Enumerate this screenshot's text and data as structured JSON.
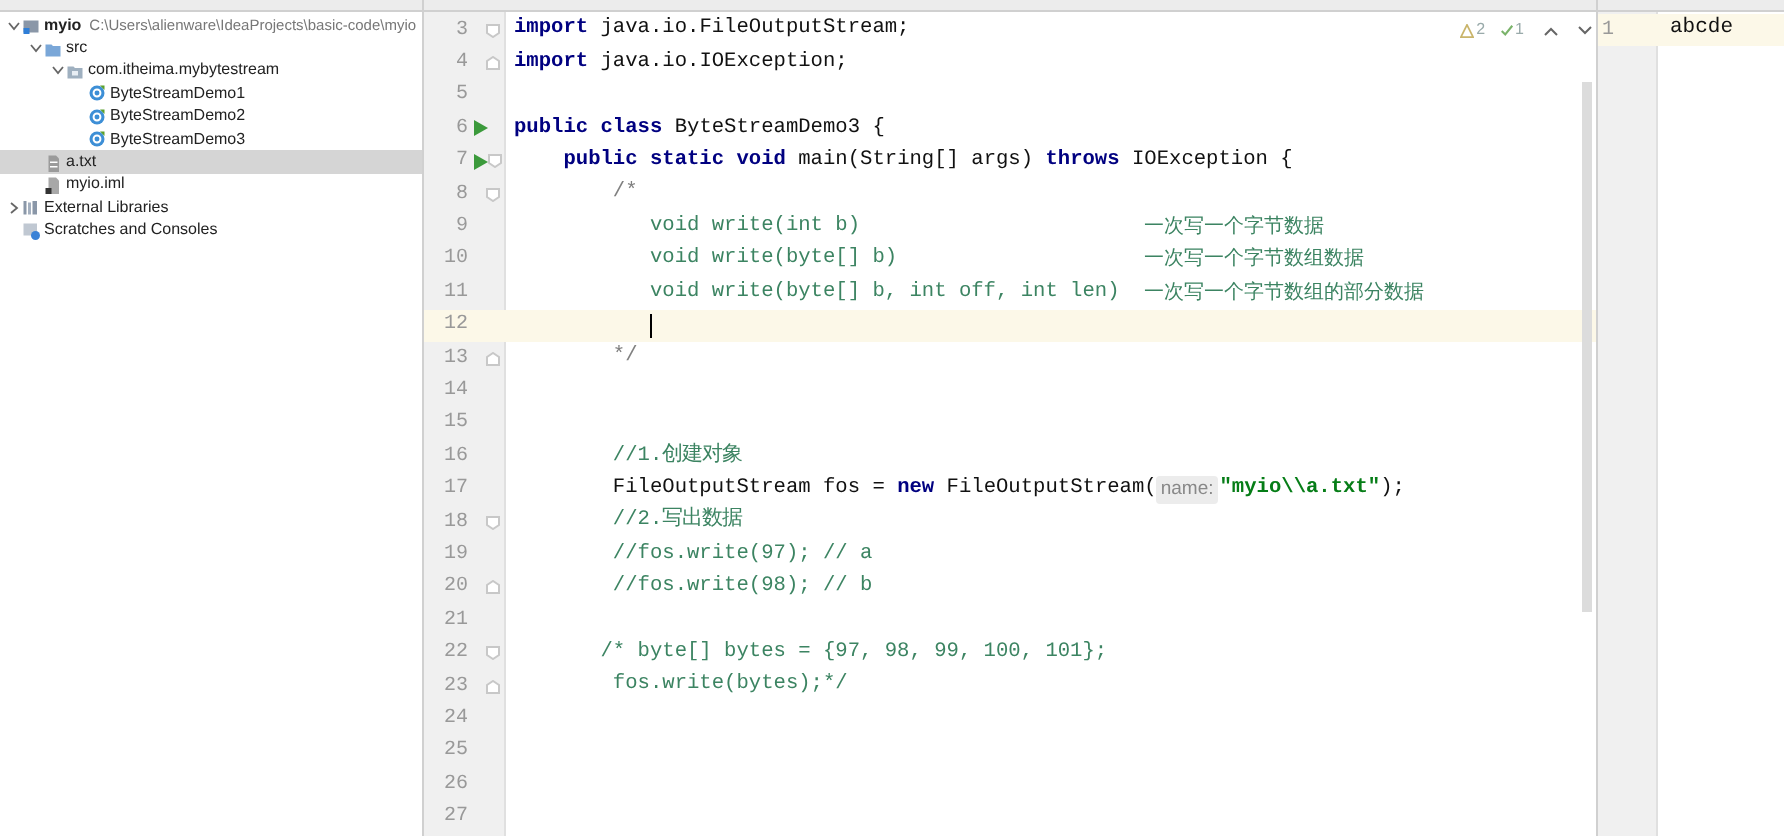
{
  "project_tree": [
    {
      "label": "myio",
      "path": "C:\\Users\\alienware\\IdeaProjects\\basic-code\\myio",
      "kind": "module",
      "expanded": true,
      "selected": false,
      "children": [
        {
          "label": "src",
          "kind": "folder",
          "expanded": true,
          "selected": false,
          "children": [
            {
              "label": "com.itheima.mybytestream",
              "kind": "package",
              "expanded": true,
              "selected": false,
              "children": [
                {
                  "label": "ByteStreamDemo1",
                  "kind": "class",
                  "selected": false
                },
                {
                  "label": "ByteStreamDemo2",
                  "kind": "class",
                  "selected": false
                },
                {
                  "label": "ByteStreamDemo3",
                  "kind": "class",
                  "selected": false
                }
              ]
            }
          ]
        },
        {
          "label": "a.txt",
          "kind": "text",
          "selected": true
        },
        {
          "label": "myio.iml",
          "kind": "iml",
          "selected": false
        }
      ]
    },
    {
      "label": "External Libraries",
      "kind": "libraries",
      "expanded": false,
      "selected": false
    },
    {
      "label": "Scratches and Consoles",
      "kind": "scratches",
      "selected": false
    }
  ],
  "inspections": {
    "warnings": "2",
    "weak_warnings": "1"
  },
  "code_lines": [
    {
      "number": "3",
      "segments": [
        {
          "kind": "keyword",
          "text": "import"
        },
        {
          "kind": "plain",
          "text": " java.io.FileOutputStream;"
        }
      ],
      "fold_open": true
    },
    {
      "number": "4",
      "segments": [
        {
          "kind": "keyword",
          "text": "import"
        },
        {
          "kind": "plain",
          "text": " java.io.IOException;"
        }
      ],
      "fold_close": true
    },
    {
      "number": "5"
    },
    {
      "number": "6",
      "segments": [
        {
          "kind": "keyword",
          "text": "public class"
        },
        {
          "kind": "plain",
          "text": " ByteStreamDemo3 {"
        }
      ],
      "run": true
    },
    {
      "number": "7",
      "segments": [
        {
          "kind": "keyword",
          "text": "    public static void"
        },
        {
          "kind": "plain",
          "text": " main(String[] args) "
        },
        {
          "kind": "keyword",
          "text": "throws"
        },
        {
          "kind": "plain",
          "text": " IOException {"
        }
      ],
      "run": true,
      "fold_open": true
    },
    {
      "number": "8",
      "segments": [
        {
          "kind": "comment-mark",
          "text": "        /*"
        }
      ],
      "fold_open": true
    },
    {
      "number": "9",
      "segments": [
        {
          "kind": "comment",
          "text": "           void write(int b)"
        }
      ],
      "note": "一次写一个字节数据"
    },
    {
      "number": "10",
      "segments": [
        {
          "kind": "comment",
          "text": "           void write(byte[] b)"
        }
      ],
      "note": "一次写一个字节数组数据"
    },
    {
      "number": "11",
      "segments": [
        {
          "kind": "comment",
          "text": "           void write(byte[] b, int off, int len)"
        }
      ],
      "note": "一次写一个字节数组的部分数据"
    },
    {
      "number": "12",
      "current": true
    },
    {
      "number": "13",
      "segments": [
        {
          "kind": "comment-mark",
          "text": "        */"
        }
      ],
      "fold_close": true
    },
    {
      "number": "14"
    },
    {
      "number": "15"
    },
    {
      "number": "16",
      "segments": [
        {
          "kind": "comment",
          "text": "        //1.创建对象"
        }
      ]
    },
    {
      "number": "17",
      "segments": [
        {
          "kind": "plain",
          "text": "        FileOutputStream fos = "
        },
        {
          "kind": "keyword",
          "text": "new"
        },
        {
          "kind": "plain",
          "text": " FileOutputStream("
        },
        {
          "kind": "hint",
          "text": "name:"
        },
        {
          "kind": "string",
          "text": "\"myio\\\\a.txt\""
        },
        {
          "kind": "plain",
          "text": ");"
        }
      ]
    },
    {
      "number": "18",
      "segments": [
        {
          "kind": "comment",
          "text": "        //2.写出数据"
        }
      ],
      "fold_open": true
    },
    {
      "number": "19",
      "segments": [
        {
          "kind": "comment",
          "text": "        //fos.write(97); // a"
        }
      ]
    },
    {
      "number": "20",
      "segments": [
        {
          "kind": "comment",
          "text": "        //fos.write(98); // b"
        }
      ],
      "fold_close": true
    },
    {
      "number": "21"
    },
    {
      "number": "22",
      "segments": [
        {
          "kind": "comment",
          "text": "       /* byte[] bytes = {97, 98, 99, 100, 101};"
        }
      ],
      "fold_open": true
    },
    {
      "number": "23",
      "segments": [
        {
          "kind": "comment",
          "text": "        fos.write(bytes);*/"
        }
      ],
      "fold_close": true
    },
    {
      "number": "24"
    },
    {
      "number": "25"
    },
    {
      "number": "26"
    },
    {
      "number": "27"
    }
  ],
  "text_file": {
    "lines": [
      {
        "number": "1",
        "text": "abcde",
        "current": true
      }
    ]
  }
}
